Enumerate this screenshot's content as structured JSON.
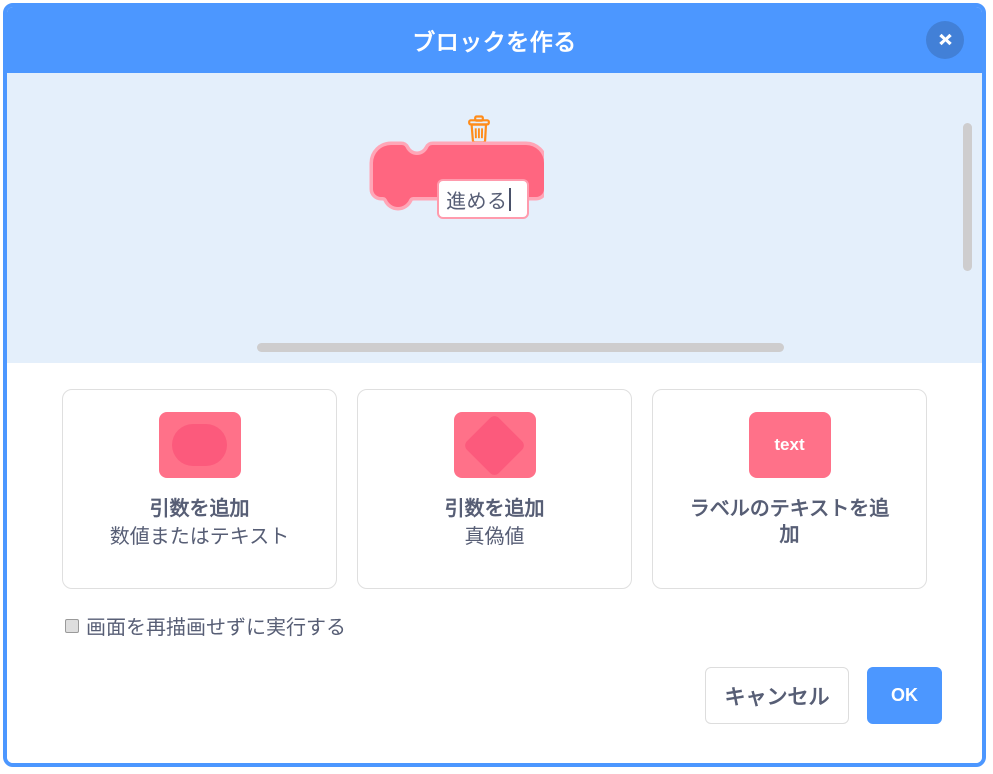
{
  "dialog": {
    "title": "ブロックを作る",
    "close_label": "✖"
  },
  "workspace": {
    "trash_icon": "trash-icon",
    "block": {
      "type": "define-hat-block",
      "color": "#FF6680",
      "input_value": "進める"
    },
    "scrollbar_h": "horizontal-scrollbar",
    "scrollbar_v": "vertical-scrollbar"
  },
  "options": [
    {
      "icon": "rounded-input-icon",
      "label": "引数を追加",
      "sub": "数値またはテキスト",
      "icon_text": ""
    },
    {
      "icon": "boolean-diamond-icon",
      "label": "引数を追加",
      "sub": "真偽値",
      "icon_text": ""
    },
    {
      "icon": "label-text-icon",
      "label": "ラベルのテキストを追加",
      "sub": "",
      "icon_text": "text"
    }
  ],
  "checkbox": {
    "label": "画面を再描画せずに実行する",
    "checked": false
  },
  "footer": {
    "cancel_label": "キャンセル",
    "ok_label": "OK"
  },
  "colors": {
    "header_blue": "#4C97FF",
    "workspace_blue": "#E4EFFB",
    "block_pink": "#FF6680",
    "icon_pink": "#FF7189",
    "text_gray": "#575E75"
  }
}
